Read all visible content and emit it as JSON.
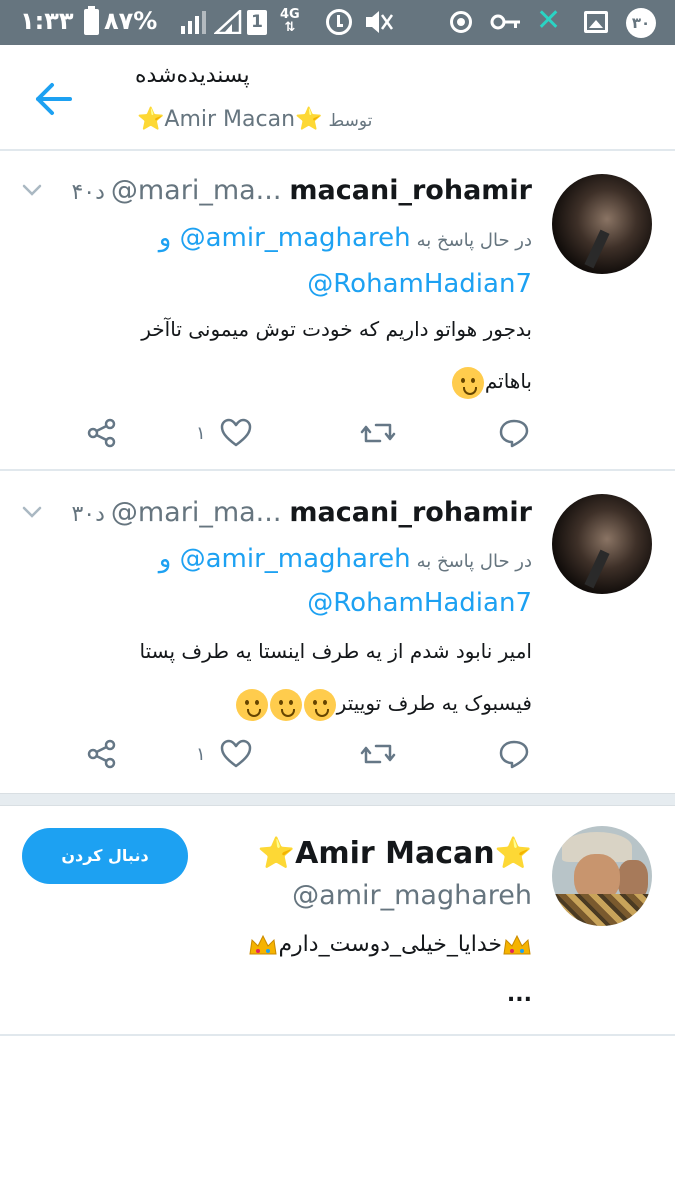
{
  "status_bar": {
    "time": "۱:۳۳",
    "battery": "۸۷%",
    "network": "4G",
    "sim": "1",
    "notification_count": "۳۰"
  },
  "header": {
    "title": "پسندیده‌شده",
    "subtitle_star_left": "⭐",
    "subtitle_name": "Amir Macan",
    "subtitle_star_right": "⭐",
    "subtitle_by": "توسط"
  },
  "tweets": [
    {
      "name": "macani_rohamir",
      "handle": "@mari_ma...",
      "time": "۴۰د",
      "replying_prefix": "در حال پاسخ به",
      "replying_to_1": "@amir_maghareh",
      "replying_and": "و",
      "replying_to_2": "@RohamHadian7",
      "text_line_1": "بدجور هواتو داریم که خودت توش میمونی تاآخر",
      "text_line_2": "باهاتم",
      "like_count": "۱"
    },
    {
      "name": "macani_rohamir",
      "handle": "@mari_ma...",
      "time": "۳۰د",
      "replying_prefix": "در حال پاسخ به",
      "replying_to_1": "@amir_maghareh",
      "replying_and": "و",
      "replying_to_2": "@RohamHadian7",
      "text_line_1": "امیر نابود شدم از یه طرف اینستا یه طرف پستا",
      "text_line_2": "فیسبوک یه طرف توییتر",
      "like_count": "۱"
    }
  ],
  "user_card": {
    "star_left": "⭐",
    "name": "Amir Macan",
    "star_right": "⭐",
    "handle": "@amir_maghareh",
    "bio": "خدایا_خیلی_دوست_دارم",
    "bio_more": "...",
    "follow_label": "دنبال کردن"
  },
  "colors": {
    "accent": "#1da1f2",
    "status_bar": "#66757f",
    "secondary_text": "#66757f",
    "separator": "#e1e8ed"
  },
  "icons": {
    "back": "arrow-left-icon",
    "caret": "chevron-down-icon",
    "share": "share-icon",
    "like": "heart-icon",
    "retweet": "retweet-icon",
    "reply": "reply-icon"
  }
}
